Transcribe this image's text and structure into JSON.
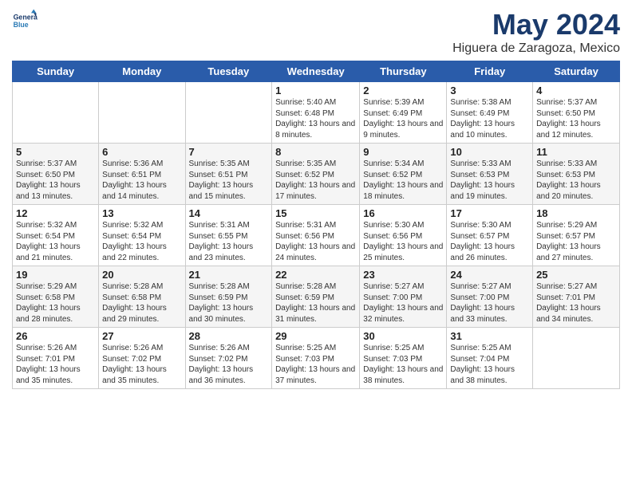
{
  "logo": {
    "line1": "General",
    "line2": "Blue"
  },
  "title": "May 2024",
  "subtitle": "Higuera de Zaragoza, Mexico",
  "days_of_week": [
    "Sunday",
    "Monday",
    "Tuesday",
    "Wednesday",
    "Thursday",
    "Friday",
    "Saturday"
  ],
  "weeks": [
    [
      {
        "day": "",
        "info": ""
      },
      {
        "day": "",
        "info": ""
      },
      {
        "day": "",
        "info": ""
      },
      {
        "day": "1",
        "info": "Sunrise: 5:40 AM\nSunset: 6:48 PM\nDaylight: 13 hours\nand 8 minutes."
      },
      {
        "day": "2",
        "info": "Sunrise: 5:39 AM\nSunset: 6:49 PM\nDaylight: 13 hours\nand 9 minutes."
      },
      {
        "day": "3",
        "info": "Sunrise: 5:38 AM\nSunset: 6:49 PM\nDaylight: 13 hours\nand 10 minutes."
      },
      {
        "day": "4",
        "info": "Sunrise: 5:37 AM\nSunset: 6:50 PM\nDaylight: 13 hours\nand 12 minutes."
      }
    ],
    [
      {
        "day": "5",
        "info": "Sunrise: 5:37 AM\nSunset: 6:50 PM\nDaylight: 13 hours\nand 13 minutes."
      },
      {
        "day": "6",
        "info": "Sunrise: 5:36 AM\nSunset: 6:51 PM\nDaylight: 13 hours\nand 14 minutes."
      },
      {
        "day": "7",
        "info": "Sunrise: 5:35 AM\nSunset: 6:51 PM\nDaylight: 13 hours\nand 15 minutes."
      },
      {
        "day": "8",
        "info": "Sunrise: 5:35 AM\nSunset: 6:52 PM\nDaylight: 13 hours\nand 17 minutes."
      },
      {
        "day": "9",
        "info": "Sunrise: 5:34 AM\nSunset: 6:52 PM\nDaylight: 13 hours\nand 18 minutes."
      },
      {
        "day": "10",
        "info": "Sunrise: 5:33 AM\nSunset: 6:53 PM\nDaylight: 13 hours\nand 19 minutes."
      },
      {
        "day": "11",
        "info": "Sunrise: 5:33 AM\nSunset: 6:53 PM\nDaylight: 13 hours\nand 20 minutes."
      }
    ],
    [
      {
        "day": "12",
        "info": "Sunrise: 5:32 AM\nSunset: 6:54 PM\nDaylight: 13 hours\nand 21 minutes."
      },
      {
        "day": "13",
        "info": "Sunrise: 5:32 AM\nSunset: 6:54 PM\nDaylight: 13 hours\nand 22 minutes."
      },
      {
        "day": "14",
        "info": "Sunrise: 5:31 AM\nSunset: 6:55 PM\nDaylight: 13 hours\nand 23 minutes."
      },
      {
        "day": "15",
        "info": "Sunrise: 5:31 AM\nSunset: 6:56 PM\nDaylight: 13 hours\nand 24 minutes."
      },
      {
        "day": "16",
        "info": "Sunrise: 5:30 AM\nSunset: 6:56 PM\nDaylight: 13 hours\nand 25 minutes."
      },
      {
        "day": "17",
        "info": "Sunrise: 5:30 AM\nSunset: 6:57 PM\nDaylight: 13 hours\nand 26 minutes."
      },
      {
        "day": "18",
        "info": "Sunrise: 5:29 AM\nSunset: 6:57 PM\nDaylight: 13 hours\nand 27 minutes."
      }
    ],
    [
      {
        "day": "19",
        "info": "Sunrise: 5:29 AM\nSunset: 6:58 PM\nDaylight: 13 hours\nand 28 minutes."
      },
      {
        "day": "20",
        "info": "Sunrise: 5:28 AM\nSunset: 6:58 PM\nDaylight: 13 hours\nand 29 minutes."
      },
      {
        "day": "21",
        "info": "Sunrise: 5:28 AM\nSunset: 6:59 PM\nDaylight: 13 hours\nand 30 minutes."
      },
      {
        "day": "22",
        "info": "Sunrise: 5:28 AM\nSunset: 6:59 PM\nDaylight: 13 hours\nand 31 minutes."
      },
      {
        "day": "23",
        "info": "Sunrise: 5:27 AM\nSunset: 7:00 PM\nDaylight: 13 hours\nand 32 minutes."
      },
      {
        "day": "24",
        "info": "Sunrise: 5:27 AM\nSunset: 7:00 PM\nDaylight: 13 hours\nand 33 minutes."
      },
      {
        "day": "25",
        "info": "Sunrise: 5:27 AM\nSunset: 7:01 PM\nDaylight: 13 hours\nand 34 minutes."
      }
    ],
    [
      {
        "day": "26",
        "info": "Sunrise: 5:26 AM\nSunset: 7:01 PM\nDaylight: 13 hours\nand 35 minutes."
      },
      {
        "day": "27",
        "info": "Sunrise: 5:26 AM\nSunset: 7:02 PM\nDaylight: 13 hours\nand 35 minutes."
      },
      {
        "day": "28",
        "info": "Sunrise: 5:26 AM\nSunset: 7:02 PM\nDaylight: 13 hours\nand 36 minutes."
      },
      {
        "day": "29",
        "info": "Sunrise: 5:25 AM\nSunset: 7:03 PM\nDaylight: 13 hours\nand 37 minutes."
      },
      {
        "day": "30",
        "info": "Sunrise: 5:25 AM\nSunset: 7:03 PM\nDaylight: 13 hours\nand 38 minutes."
      },
      {
        "day": "31",
        "info": "Sunrise: 5:25 AM\nSunset: 7:04 PM\nDaylight: 13 hours\nand 38 minutes."
      },
      {
        "day": "",
        "info": ""
      }
    ]
  ],
  "colors": {
    "header_bg": "#2a5caa",
    "header_text": "#ffffff",
    "title_color": "#1a3a6b"
  }
}
